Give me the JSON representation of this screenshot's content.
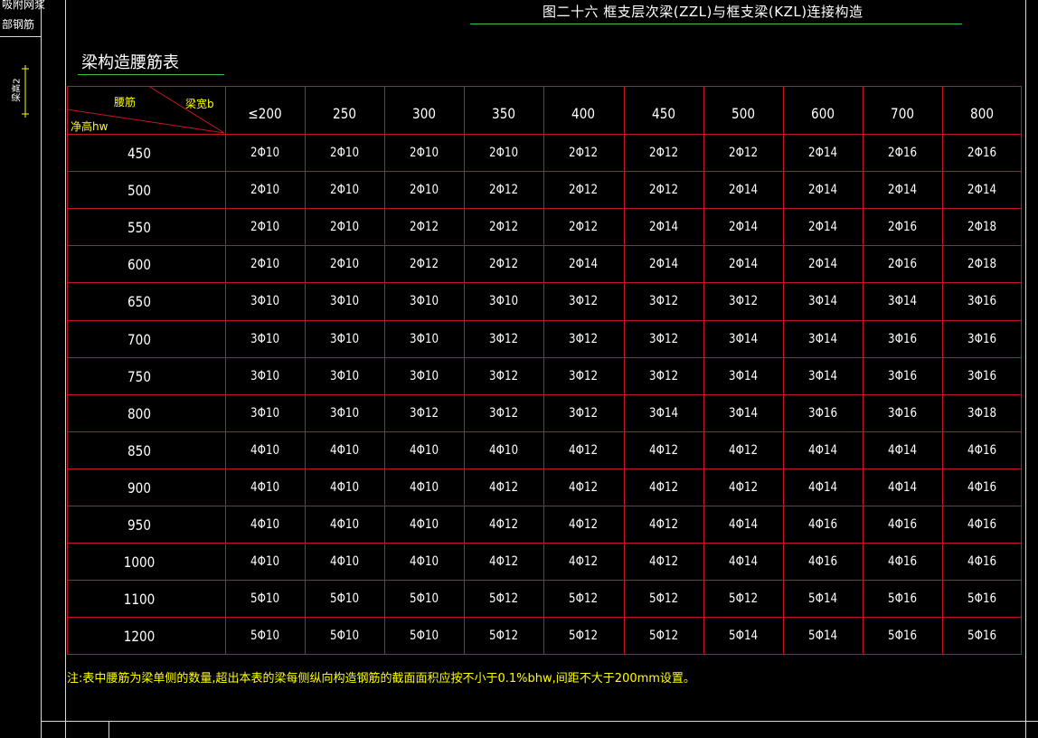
{
  "left_panel": {
    "label_top_1": "吸附网浆",
    "label_top_2": "部钢筋",
    "dimension_label": "梁高2"
  },
  "drawing": {
    "title": "图二十六  框支层次梁(ZZL)与框支梁(KZL)连接构造",
    "table_heading": "梁构造腰筋表"
  },
  "table": {
    "corner": {
      "rebar_label": "腰筋",
      "width_label": "梁宽b",
      "height_label": "净高hw"
    },
    "columns": [
      "≤200",
      "250",
      "300",
      "350",
      "400",
      "450",
      "500",
      "600",
      "700",
      "800"
    ],
    "rows": [
      {
        "hw": "450",
        "cells": [
          "2Φ10",
          "2Φ10",
          "2Φ10",
          "2Φ10",
          "2Φ12",
          "2Φ12",
          "2Φ12",
          "2Φ14",
          "2Φ16",
          "2Φ16"
        ]
      },
      {
        "hw": "500",
        "cells": [
          "2Φ10",
          "2Φ10",
          "2Φ10",
          "2Φ12",
          "2Φ12",
          "2Φ12",
          "2Φ14",
          "2Φ14",
          "2Φ14",
          "2Φ14"
        ]
      },
      {
        "hw": "550",
        "cells": [
          "2Φ10",
          "2Φ10",
          "2Φ12",
          "2Φ12",
          "2Φ12",
          "2Φ14",
          "2Φ14",
          "2Φ14",
          "2Φ16",
          "2Φ18"
        ]
      },
      {
        "hw": "600",
        "cells": [
          "2Φ10",
          "2Φ10",
          "2Φ12",
          "2Φ12",
          "2Φ14",
          "2Φ14",
          "2Φ14",
          "2Φ14",
          "2Φ16",
          "2Φ18"
        ]
      },
      {
        "hw": "650",
        "cells": [
          "3Φ10",
          "3Φ10",
          "3Φ10",
          "3Φ10",
          "3Φ12",
          "3Φ12",
          "3Φ12",
          "3Φ14",
          "3Φ14",
          "3Φ16"
        ]
      },
      {
        "hw": "700",
        "cells": [
          "3Φ10",
          "3Φ10",
          "3Φ10",
          "3Φ12",
          "3Φ12",
          "3Φ12",
          "3Φ14",
          "3Φ14",
          "3Φ16",
          "3Φ16"
        ]
      },
      {
        "hw": "750",
        "cells": [
          "3Φ10",
          "3Φ10",
          "3Φ10",
          "3Φ12",
          "3Φ12",
          "3Φ12",
          "3Φ14",
          "3Φ14",
          "3Φ16",
          "3Φ16"
        ]
      },
      {
        "hw": "800",
        "cells": [
          "3Φ10",
          "3Φ10",
          "3Φ12",
          "3Φ12",
          "3Φ12",
          "3Φ14",
          "3Φ14",
          "3Φ16",
          "3Φ16",
          "3Φ18"
        ]
      },
      {
        "hw": "850",
        "cells": [
          "4Φ10",
          "4Φ10",
          "4Φ10",
          "4Φ10",
          "4Φ12",
          "4Φ12",
          "4Φ12",
          "4Φ14",
          "4Φ14",
          "4Φ16"
        ]
      },
      {
        "hw": "900",
        "cells": [
          "4Φ10",
          "4Φ10",
          "4Φ10",
          "4Φ12",
          "4Φ12",
          "4Φ12",
          "4Φ12",
          "4Φ14",
          "4Φ14",
          "4Φ16"
        ]
      },
      {
        "hw": "950",
        "cells": [
          "4Φ10",
          "4Φ10",
          "4Φ10",
          "4Φ12",
          "4Φ12",
          "4Φ12",
          "4Φ14",
          "4Φ16",
          "4Φ16",
          "4Φ16"
        ]
      },
      {
        "hw": "1000",
        "cells": [
          "4Φ10",
          "4Φ10",
          "4Φ10",
          "4Φ12",
          "4Φ12",
          "4Φ12",
          "4Φ14",
          "4Φ16",
          "4Φ16",
          "4Φ16"
        ]
      },
      {
        "hw": "1100",
        "cells": [
          "5Φ10",
          "5Φ10",
          "5Φ10",
          "5Φ12",
          "5Φ12",
          "5Φ12",
          "5Φ12",
          "5Φ14",
          "5Φ16",
          "5Φ16"
        ]
      },
      {
        "hw": "1200",
        "cells": [
          "5Φ10",
          "5Φ10",
          "5Φ10",
          "5Φ12",
          "5Φ12",
          "5Φ12",
          "5Φ14",
          "5Φ14",
          "5Φ16",
          "5Φ16"
        ]
      }
    ]
  },
  "note": "注:表中腰筋为梁单侧的数量,超出本表的梁每侧纵向构造钢筋的截面面积应按不小于0.1%bhw,间距不大于200mm设置。",
  "colors": {
    "background": "#000000",
    "table_lines": "#c81428",
    "frame_lines": "#d8d8d8",
    "note_text": "#ffff00",
    "underline": "#3fbf3f"
  }
}
